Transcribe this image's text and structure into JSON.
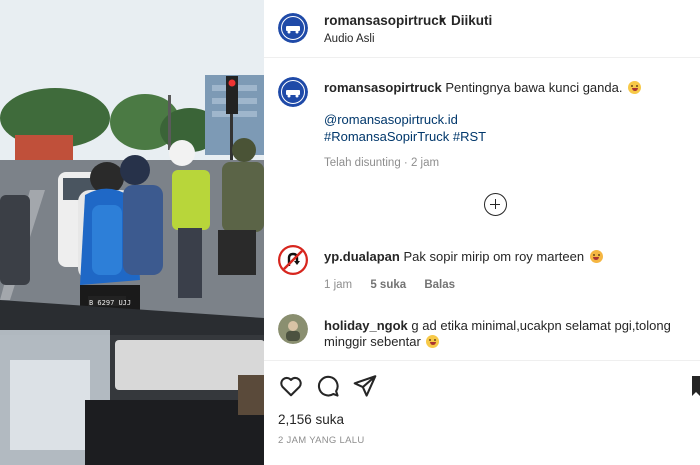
{
  "post": {
    "username": "romansasopirtruck",
    "separator": "•",
    "follow_status": "Diikuti",
    "audio": "Audio Asli"
  },
  "caption": {
    "username": "romansasopirtruck",
    "text": "Pentingnya bawa kunci ganda.",
    "mention": "@romansasopirtruck.id",
    "hashtags": "#RomansaSopirTruck #RST",
    "meta": "Telah disunting · 2 jam"
  },
  "comments": [
    {
      "username": "yp.dualapan",
      "text": "Pak sopir mirip om roy marteen",
      "time": "1 jam",
      "likes": "5 suka",
      "reply": "Balas"
    },
    {
      "username": "holiday_ngok",
      "text_line1": "g ad etika minimal,ucakpn selamat pgi,tolong",
      "text_line2": "minggir sebentar"
    }
  ],
  "footer": {
    "likes": "2,156 suka",
    "time": "2 JAM YANG LALU"
  },
  "media": {
    "plate_text": "B 6297 UJJ"
  },
  "icons": {
    "like": "heart-icon",
    "comment": "comment-icon",
    "share": "share-icon",
    "save": "bookmark-icon",
    "add_comment": "plus-circle-icon"
  },
  "colors": {
    "text": "#262626",
    "muted": "#8e8e8e",
    "link": "#00376b",
    "avatar_brand": "#1f4aa8"
  }
}
